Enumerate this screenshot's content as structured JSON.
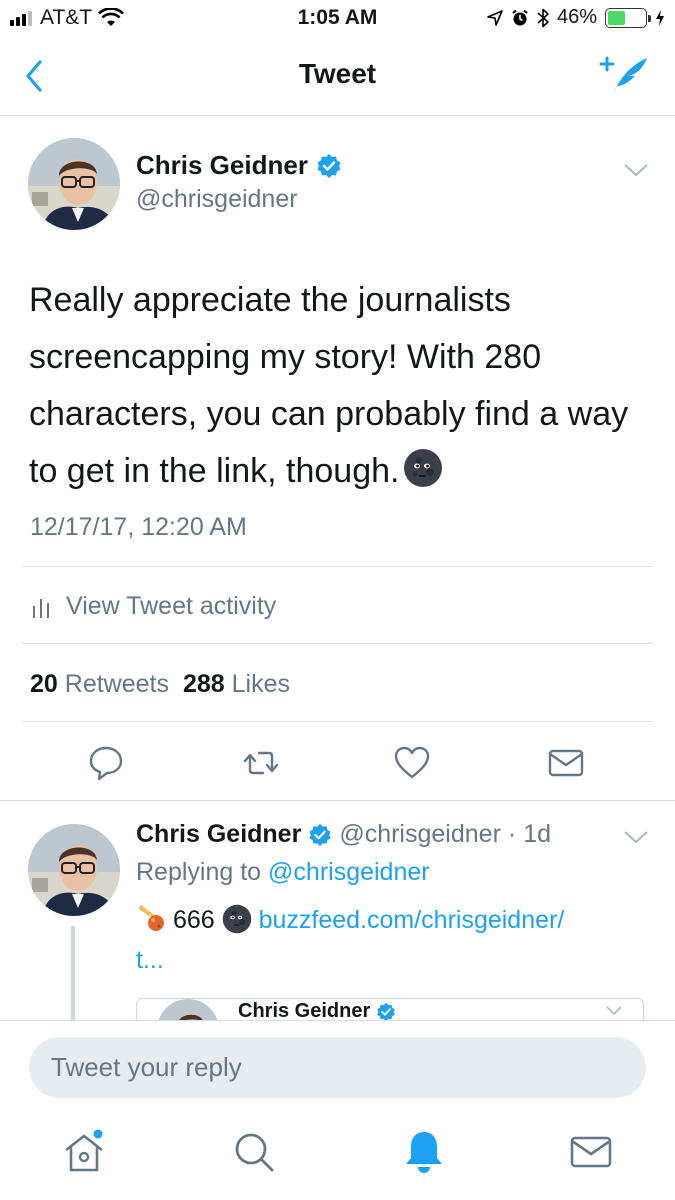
{
  "status_bar": {
    "carrier": "AT&T",
    "time": "1:05 AM",
    "battery": "46%",
    "battery_level": 0.46
  },
  "nav": {
    "title": "Tweet",
    "back_icon": "chevron-left-icon",
    "compose_icon": "compose-tweet-icon"
  },
  "main_tweet": {
    "author_name": "Chris Geidner",
    "author_handle": "@chrisgeidner",
    "text": "Really appreciate the journalists screencapping my story! With 280 characters, you can probably find a way to get in the link, though.",
    "emoji": "new-moon-face",
    "timestamp": "12/17/17, 12:20 AM",
    "activity_label": "View Tweet activity",
    "retweet_count": "20",
    "retweet_label": "Retweets",
    "like_count": "288",
    "like_label": "Likes"
  },
  "reply_tweet": {
    "author_name": "Chris Geidner",
    "author_handle": "@chrisgeidner",
    "separator": "·",
    "age": "1d",
    "replying_prefix": "Replying to",
    "replying_to": "@chrisgeidner",
    "number": "666",
    "link_line1": "buzzfeed.com/chrisgeidner/",
    "link_line2": "t...",
    "quoted_author_name": "Chris Geidner"
  },
  "reply_bar": {
    "placeholder": "Tweet your reply"
  },
  "tab_bar": {
    "tabs": [
      "home-icon",
      "search-icon",
      "notifications-bell-icon",
      "messages-envelope-icon"
    ],
    "active_tab": "notifications-bell-icon"
  },
  "colors": {
    "accent": "#1da1f2",
    "text_primary": "#14171a",
    "text_secondary": "#657786",
    "divider": "#d8dde1",
    "battery_green": "#4cd964"
  }
}
